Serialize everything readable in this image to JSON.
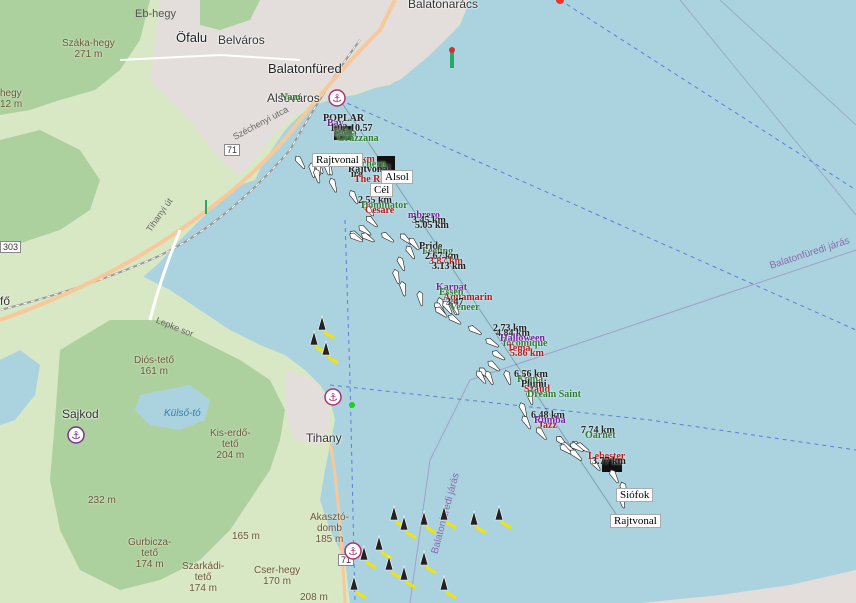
{
  "map": {
    "places": {
      "balatonaracs": "Balatonarács",
      "eb_hegy": "Eb-hegy",
      "ofalu": "Öfalu",
      "belvaros": "Belváros",
      "balatonfured": "Balatonfüred",
      "alsovaros": "Alsóváros",
      "tihany": "Tihany",
      "sajkod": "Sajkod",
      "kulso_to": "Külső-tó",
      "szechenyi_utca": "Széchenyi utca",
      "tihanyi_ut": "Tihanyi út",
      "lepke_sor": "Lepke sor",
      "fo": "fő",
      "balatonfuredi_jaras": "Balatonfüredi járás",
      "balatonfuredi_jaras_2": "Balatonfüredi járás"
    },
    "peaks": {
      "szaka_hegy": "Száka-hegy",
      "szaka_hegy_ele": "271 m",
      "left_hegy": "hegy",
      "left_ele": "12 m",
      "dios_teto": "Diós-tető",
      "dios_ele": "161 m",
      "kis_erdo": "Kis-erdő-",
      "kis_erdo_2": "tető",
      "kis_erdo_ele": "204 m",
      "m232": "232 m",
      "m165": "165 m",
      "akaszto": "Akasztó-",
      "akaszto_2": "domb",
      "akaszto_ele": "185 m",
      "gurbicza": "Gurbicza-",
      "gurbicza_2": "tető",
      "gurbicza_ele": "174 m",
      "szarkadi": "Szarkádi-",
      "szarkadi_2": "tető",
      "szarkadi_ele": "174 m",
      "cser_hegy": "Cser-hegy",
      "cser_ele": "170 m",
      "m208": "208 m"
    },
    "roads": {
      "r71": "71",
      "r71b": "71",
      "r303": "303"
    },
    "race_tags": {
      "cel": "Cél",
      "rajtvonal_top": "Rajtvonal",
      "siofok": "Siófok",
      "rajtvonal_bottom": "Rajtvonal",
      "alsol": "Alsol"
    },
    "boat_labels": [
      {
        "t": "Nam",
        "c": "#2e7d32"
      },
      {
        "t": "POPLAR",
        "c": "#222"
      },
      {
        "t": "Bay",
        "c": "#7b1fa2"
      },
      {
        "t": "1.02 10.57",
        "c": "#222"
      },
      {
        "t": "Delta",
        "c": "#2e7d32"
      },
      {
        "t": "Grazzana",
        "c": "#2e7d32"
      },
      {
        "t": "0.93 km",
        "c": "#b71c1c"
      },
      {
        "t": "Ranchern",
        "c": "#2e7d32"
      },
      {
        "t": "Rajtvonal",
        "c": "#222"
      },
      {
        "t": "ire",
        "c": "#222"
      },
      {
        "t": "The Rel",
        "c": "#b71c1c"
      },
      {
        "t": "2.55 km",
        "c": "#222"
      },
      {
        "t": "Dominator",
        "c": "#2e7d32"
      },
      {
        "t": "Cesare",
        "c": "#b71c1c"
      },
      {
        "t": "mbrero",
        "c": "#7b1fa2"
      },
      {
        "t": "3.45 km",
        "c": "#222"
      },
      {
        "t": "5.05 km",
        "c": "#222"
      },
      {
        "t": "Pride",
        "c": "#222"
      },
      {
        "t": "Feeling",
        "c": "#2e7d32"
      },
      {
        "t": "2.67 km",
        "c": "#222"
      },
      {
        "t": "3.87 km",
        "c": "#b71c1c"
      },
      {
        "t": "3.13 km",
        "c": "#222"
      },
      {
        "t": "Karpat",
        "c": "#7b1fa2"
      },
      {
        "t": "Essen",
        "c": "#2e7d32"
      },
      {
        "t": "Aquamarin",
        "c": "#b71c1c"
      },
      {
        "t": "3.47",
        "c": "#222"
      },
      {
        "t": "Veneer",
        "c": "#2e7d32"
      },
      {
        "t": "2.73 km",
        "c": "#222"
      },
      {
        "t": "4.84 km",
        "c": "#222"
      },
      {
        "t": "Halloween",
        "c": "#7b1fa2"
      },
      {
        "t": "focomique",
        "c": "#2e7d32"
      },
      {
        "t": "Tema",
        "c": "#b71c1c"
      },
      {
        "t": "5.86 km",
        "c": "#b71c1c"
      },
      {
        "t": "6.56 km",
        "c": "#222"
      },
      {
        "t": "Koma",
        "c": "#2e7d32"
      },
      {
        "t": "Plumi",
        "c": "#222"
      },
      {
        "t": "Szaud",
        "c": "#b71c1c"
      },
      {
        "t": "Dream Saint",
        "c": "#2e7d32"
      },
      {
        "t": "6.48 km",
        "c": "#222"
      },
      {
        "t": "Rumba",
        "c": "#7b1fa2"
      },
      {
        "t": "Jazz",
        "c": "#b71c1c"
      },
      {
        "t": "7.74 km",
        "c": "#222"
      },
      {
        "t": "Oarnet",
        "c": "#2e7d32"
      },
      {
        "t": "Lebester",
        "c": "#b71c1c"
      },
      {
        "t": "3.77 km",
        "c": "#222"
      }
    ]
  }
}
